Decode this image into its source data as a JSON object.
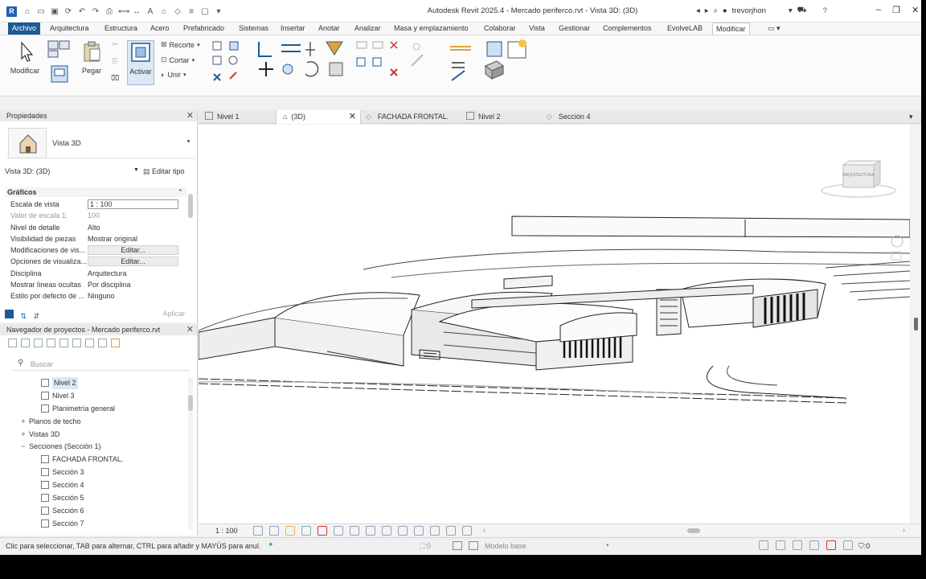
{
  "titlebar": {
    "app_logo": "R",
    "title": "Autodesk Revit 2025.4 - Mercado periferco.rvt - Vista 3D: (3D)",
    "username": "trevorjhon"
  },
  "menu": {
    "tabs": [
      "Archivo",
      "Arquitectura",
      "Estructura",
      "Acero",
      "Prefabricado",
      "Sistemas",
      "Insertar",
      "Anotar",
      "Analizar",
      "Masa y emplazamiento",
      "Colaborar",
      "Vista",
      "Gestionar",
      "Complementos",
      "EvolveLAB",
      "Modificar"
    ]
  },
  "ribbon": {
    "modify": "Modificar",
    "paste": "Pegar",
    "activate": "Activar",
    "cut_geometry": "Recorte",
    "cut": "Cortar",
    "join": "Unir"
  },
  "properties": {
    "title": "Propiedades",
    "type_name": "Vista 3D",
    "instance": "Vista 3D: (3D)",
    "edit_type": "Editar tipo",
    "section": "Gráficos",
    "rows": [
      {
        "k": "Escala de vista",
        "v": "1 : 100"
      },
      {
        "k": "Valor de escala    1:",
        "v": "100"
      },
      {
        "k": "Nivel de detalle",
        "v": "Alto"
      },
      {
        "k": "Visibilidad de piezas",
        "v": "Mostrar original"
      },
      {
        "k": "Modificaciones de vis...",
        "v": "Editar..."
      },
      {
        "k": "Opciones de visualiza...",
        "v": "Editar..."
      },
      {
        "k": "Disciplina",
        "v": "Arquitectura"
      },
      {
        "k": "Mostrar líneas ocultas",
        "v": "Por disciplina"
      },
      {
        "k": "Estilo por defecto de ...",
        "v": "Ninguno"
      }
    ],
    "apply": "Aplicar"
  },
  "navigator": {
    "title": "Navegador de proyectos - Mercado periferco.rvt",
    "search_placeholder": "Buscar",
    "items": [
      {
        "label": "Nivel 2",
        "level": 2,
        "pm": ""
      },
      {
        "label": "Nivel 3",
        "level": 2,
        "pm": ""
      },
      {
        "label": "Planimetría general",
        "level": 2,
        "pm": ""
      },
      {
        "label": "Planos de techo",
        "level": 1,
        "pm": "+"
      },
      {
        "label": "Vistas 3D",
        "level": 1,
        "pm": "+"
      },
      {
        "label": "Secciones (Sección 1)",
        "level": 1,
        "pm": "−"
      },
      {
        "label": "FACHADA FRONTAL.",
        "level": 2,
        "pm": ""
      },
      {
        "label": "Sección 3",
        "level": 2,
        "pm": ""
      },
      {
        "label": "Sección 4",
        "level": 2,
        "pm": ""
      },
      {
        "label": "Sección 5",
        "level": 2,
        "pm": ""
      },
      {
        "label": "Sección 6",
        "level": 2,
        "pm": ""
      },
      {
        "label": "Sección 7",
        "level": 2,
        "pm": ""
      }
    ]
  },
  "view_tabs": [
    "Nivel 1",
    "(3D)",
    "FACHADA FRONTAL.",
    "Nivel 2",
    "Sección 4"
  ],
  "view": {
    "scale": "1 : 100",
    "viewcube_label": "ARQUITECTURA"
  },
  "status": {
    "text": "Clic para seleccionar, TAB para alternar, CTRL para añadir y MAYÚS para anul.",
    "selection_count": ":0",
    "model": "Modelo base",
    "filter_count": ":0"
  },
  "colors": {
    "accent": "#1d5a98",
    "logo": "#1f5fb4"
  }
}
